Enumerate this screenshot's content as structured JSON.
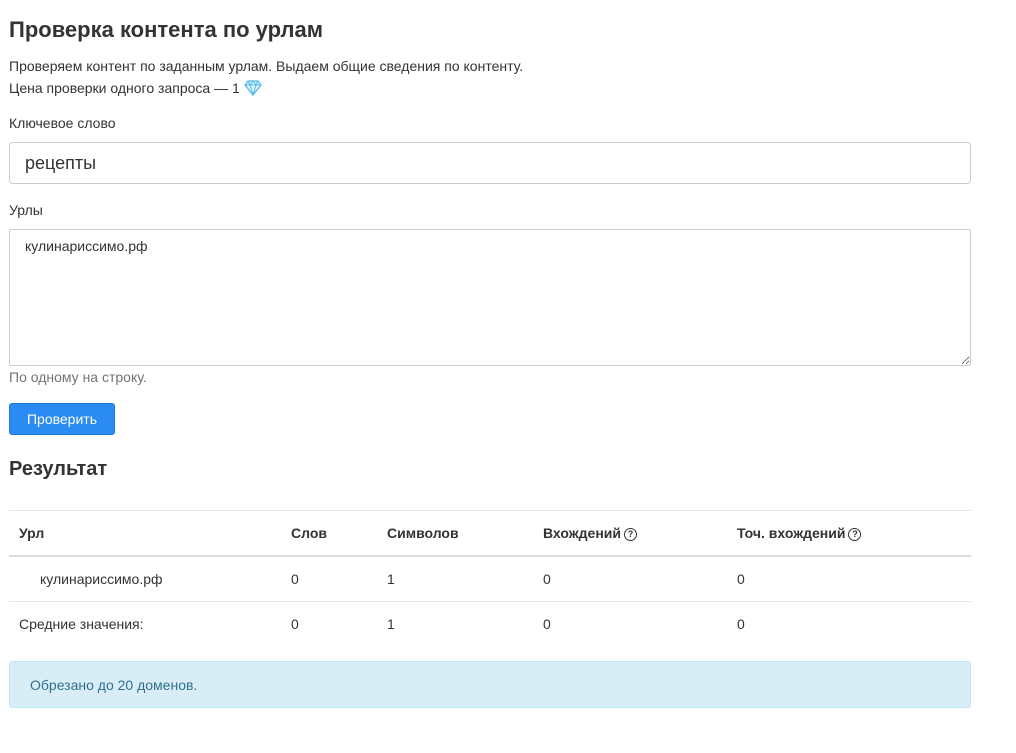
{
  "header": {
    "title": "Проверка контента по урлам",
    "description": "Проверяем контент по заданным урлам. Выдаем общие сведения по контенту.",
    "price_text": "Цена проверки одного запроса — 1",
    "price_icon": "gem-icon"
  },
  "form": {
    "keyword_label": "Ключевое слово",
    "keyword_value": "рецепты",
    "urls_label": "Урлы",
    "urls_value": "кулинариссимо.рф",
    "urls_help": "По одному на строку.",
    "submit_label": "Проверить"
  },
  "results": {
    "title": "Результат",
    "columns": [
      "Урл",
      "Слов",
      "Символов",
      "Вхождений",
      "Точ. вхождений"
    ],
    "help_icon": "question-circle-icon",
    "rows": [
      {
        "url": "кулинариссимо.рф",
        "words": "0",
        "chars": "1",
        "occurrences": "0",
        "exact": "0"
      }
    ],
    "average": {
      "label": "Средние значения:",
      "words": "0",
      "chars": "1",
      "occurrences": "0",
      "exact": "0"
    }
  },
  "alert": {
    "text": "Обрезано до 20 доменов."
  },
  "colors": {
    "primary_button": "#2a8bf2",
    "alert_bg": "#d9edf7",
    "alert_text": "#31708f",
    "gem": "#4fb8e6"
  }
}
